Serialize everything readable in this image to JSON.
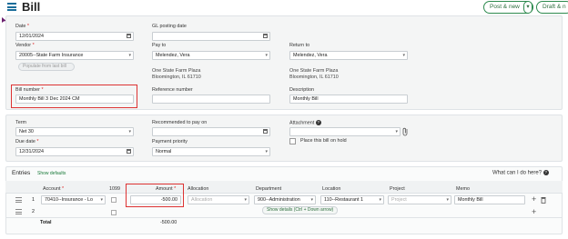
{
  "header": {
    "title": "Bill",
    "post_new": "Post & new",
    "draft_new": "Draft & n"
  },
  "form": {
    "date": {
      "label": "Date",
      "value": "12/01/2024"
    },
    "gl_posting_date": {
      "label": "GL posting date",
      "value": ""
    },
    "vendor": {
      "label": "Vendor",
      "value": "20005--State Farm Insurance"
    },
    "populate_button": "Populate from last bill",
    "pay_to": {
      "label": "Pay to",
      "value": "Melendez, Vera",
      "address_line1": "One State Farm Plaza",
      "address_line2": "Bloomington, IL 61710"
    },
    "return_to": {
      "label": "Return to",
      "value": "Melendez, Vera",
      "address_line1": "One State Farm Plaza",
      "address_line2": "Bloomington, IL 61710"
    },
    "bill_number": {
      "label": "Bill number",
      "value": "Monthly Bill 3 Dec 2024 CM"
    },
    "reference_number": {
      "label": "Reference number",
      "value": ""
    },
    "description": {
      "label": "Description",
      "value": "Monthly Bill"
    },
    "term": {
      "label": "Term",
      "value": "Net 30"
    },
    "recommended_pay_on": {
      "label": "Recommended to pay on",
      "value": ""
    },
    "attachment": {
      "label": "Attachment",
      "value": ""
    },
    "due_date": {
      "label": "Due date",
      "value": "12/31/2024"
    },
    "payment_priority": {
      "label": "Payment priority",
      "value": "Normal"
    },
    "place_on_hold": "Place this bill on hold"
  },
  "entries": {
    "title": "Entries",
    "show_defaults": "Show defaults",
    "help": "What can I do here?",
    "columns": {
      "account": "Account",
      "c1099": "1099",
      "amount": "Amount",
      "allocation": "Allocation",
      "department": "Department",
      "location": "Location",
      "project": "Project",
      "memo": "Memo"
    },
    "rows": [
      {
        "num": "1",
        "account": "70410--Insurance - Lo",
        "amount": "-500.00",
        "allocation_placeholder": "Allocation",
        "department": "900--Administration",
        "location": "110--Restaurant 1",
        "project_placeholder": "Project",
        "memo": "Monthly Bill"
      },
      {
        "num": "2"
      }
    ],
    "tooltip": "Show details (Ctrl + Down arrow)",
    "total_label": "Total",
    "total_value": "-500.00"
  }
}
